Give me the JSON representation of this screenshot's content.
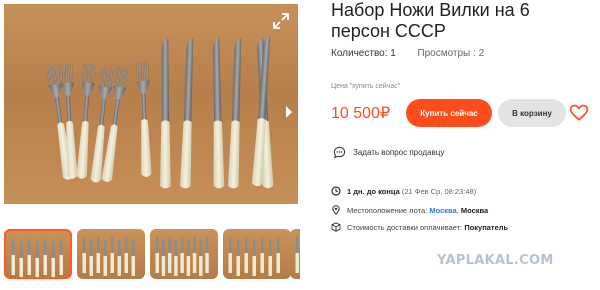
{
  "listing": {
    "title": "Набор Ножи Вилки на 6 персон СССР",
    "quantity_label": "Количество:",
    "quantity_value": "1",
    "views_label": "Просмотры :",
    "views_value": "2",
    "price_caption": "Цена \"купить сейчас\"",
    "price": "10 500₽"
  },
  "actions": {
    "buy_now": "Купить сейчас",
    "add_to_cart": "В корзину",
    "ask_seller": "Задать вопрос продавцу"
  },
  "details": {
    "time_left": "1 дн. до конца",
    "end_date": "(21 Фев Ср, 08:23:48)",
    "location_label": "Местоположение лота:",
    "location_city": "Москва",
    "location_sep": ",",
    "location_region": "Москва",
    "shipping_label": "Стоимость доставки оплачивает:",
    "shipping_payer": "Покупатель"
  },
  "gallery": {
    "thumbnails": [
      "thumb-1",
      "thumb-2",
      "thumb-3",
      "thumb-4",
      "thumb-5"
    ],
    "active_thumbnail": 0
  },
  "icons": {
    "expand": "expand-icon",
    "next": "chevron-right-icon",
    "favorite": "heart-icon",
    "ask": "chat-icon",
    "time": "clock-icon",
    "location": "pin-icon",
    "shipping": "box-icon"
  },
  "colors": {
    "accent": "#ff4c1d",
    "link": "#2a7ae2",
    "secondary_button": "#e4e4e4"
  },
  "watermark": "YAPLAKAL.COM"
}
